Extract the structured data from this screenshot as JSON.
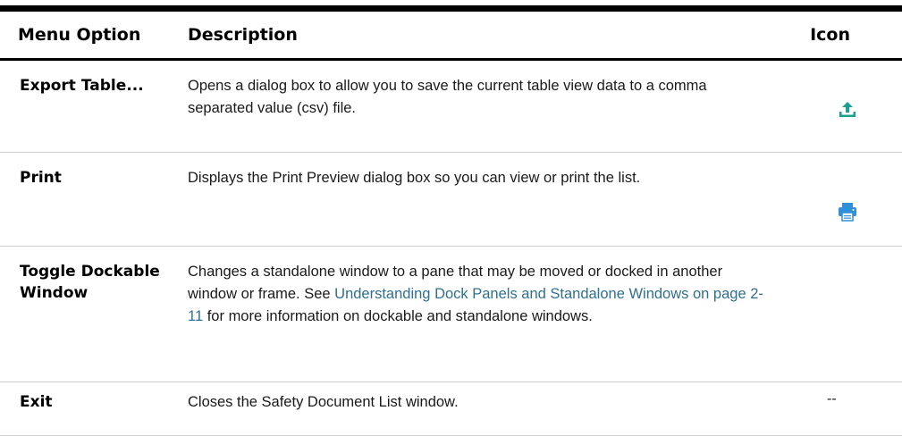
{
  "header": {
    "col_option": "Menu Option",
    "col_description": "Description",
    "col_icon": "Icon"
  },
  "rows": [
    {
      "option": "Export Table...",
      "description": "Opens a dialog box to allow you to save the current table view data to a comma separated value (csv) file.",
      "icon": "export-upload-icon",
      "icon_color": "#1aa08e"
    },
    {
      "option": "Print",
      "description": "Displays the Print Preview dialog box so you can view or print the list.",
      "icon": "printer-icon",
      "icon_color": "#2f8fd8"
    },
    {
      "option": "Toggle Dockable Window",
      "description_before_link": "Changes a standalone window to a pane that may be moved or docked in another window or frame. See ",
      "link_text": "Understanding Dock Panels and Standalone Windows on page 2-11",
      "description_after_link": " for more information on dockable and standalone windows.",
      "icon": "",
      "link_color": "#2f6f8f"
    },
    {
      "option": "Exit",
      "description": "Closes the Safety Document List window.",
      "icon_text": "--"
    }
  ]
}
